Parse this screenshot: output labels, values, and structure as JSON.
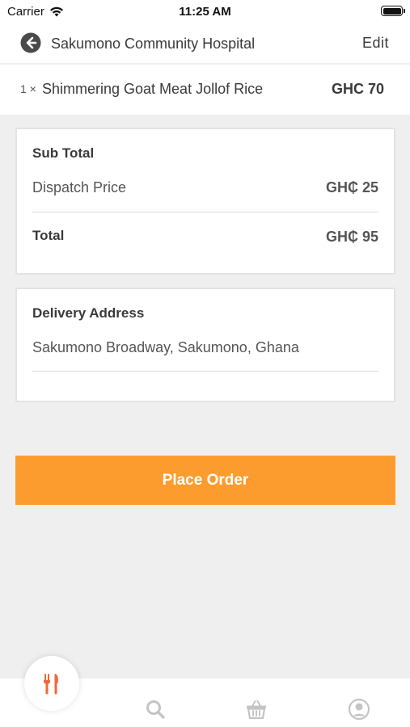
{
  "status_bar": {
    "carrier": "Carrier",
    "time": "11:25 AM"
  },
  "nav": {
    "title": "Sakumono Community Hospital",
    "edit_label": "Edit"
  },
  "cart_item": {
    "quantity": "1 ×",
    "name": "Shimmering Goat Meat Jollof Rice",
    "price": "GHC 70"
  },
  "summary": {
    "subtotal_label": "Sub Total",
    "dispatch_label": "Dispatch Price",
    "dispatch_amount": "GH₵ 25",
    "total_label": "Total",
    "total_amount": "GH₵ 95"
  },
  "delivery": {
    "heading": "Delivery Address",
    "address": "Sakumono Broadway, Sakumono, Ghana"
  },
  "actions": {
    "place_order_label": "Place Order"
  },
  "tab_bar": {
    "items": [
      "restaurant-icon",
      "search-icon",
      "basket-icon",
      "profile-icon"
    ]
  },
  "colors": {
    "accent": "#fd9c2e",
    "active_icon": "#f0683a",
    "inactive_icon": "#c4c4c4",
    "background": "#efefef"
  }
}
